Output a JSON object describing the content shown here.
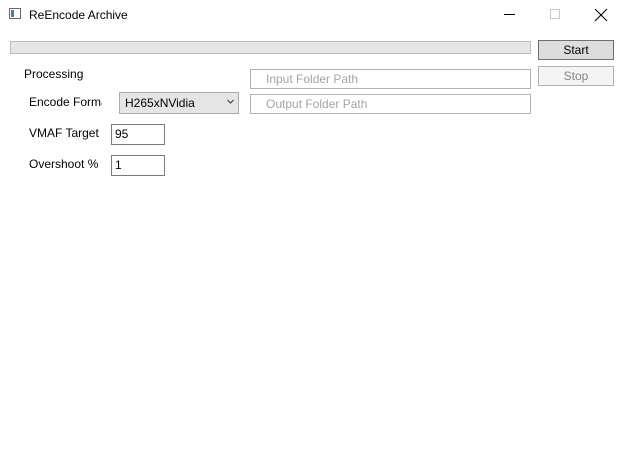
{
  "window": {
    "title": "ReEncode Archive"
  },
  "progress": {
    "fraction": 0
  },
  "controls": {
    "start_label": "Start",
    "stop_label": "Stop",
    "processing_label": "Processing",
    "encode_format_label": "Encode Forma",
    "encode_format_selected": "H265xNVidia",
    "vmaf_label": "VMAF Target",
    "vmaf_value": "95",
    "overshoot_label": "Overshoot %",
    "overshoot_value": "1",
    "input_path_placeholder": "Input Folder Path",
    "output_path_placeholder": "Output Folder Path"
  },
  "icons": {
    "app": "app-window-icon",
    "minimize": "minimize-icon",
    "maximize": "maximize-icon",
    "close": "close-icon",
    "dropdown": "chevron-down-icon"
  },
  "colors": {
    "progress_fill": "#06b025",
    "start_bg": "#dddddd",
    "disabled_text": "#838383",
    "placeholder_text": "#a5a5a5"
  }
}
